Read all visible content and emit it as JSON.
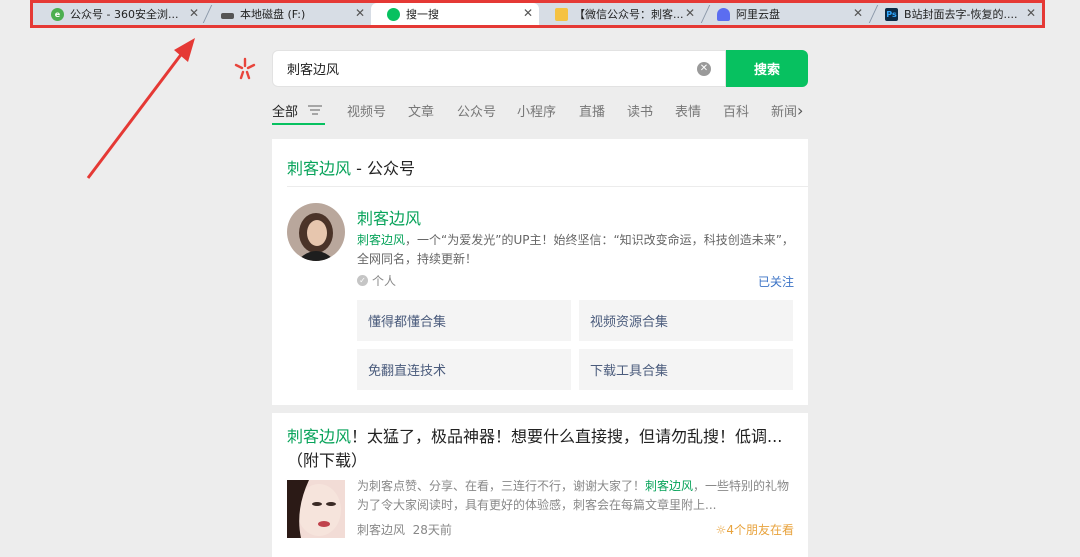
{
  "tabs": [
    {
      "label": "公众号 - 360安全浏...",
      "icon": "ie-icon",
      "color": "#4caf50"
    },
    {
      "label": "本地磁盘 (F:)",
      "icon": "disk-icon",
      "color": "#555555"
    },
    {
      "label": "搜一搜",
      "icon": "wechat-icon",
      "color": "#07c160"
    },
    {
      "label": "【微信公众号：刺客...",
      "icon": "doc-icon",
      "color": "#f5c242"
    },
    {
      "label": "阿里云盘",
      "icon": "cloud-icon",
      "color": "#5b6df0"
    },
    {
      "label": "B站封面去字-恢复的....",
      "icon": "photoshop-icon",
      "color": "#0d2b45"
    }
  ],
  "search": {
    "value": "刺客边风",
    "button": "搜索"
  },
  "categories": [
    "全部",
    "视频号",
    "文章",
    "公众号",
    "小程序",
    "直播",
    "读书",
    "表情",
    "百科",
    "新闻"
  ],
  "account_card": {
    "title_highlight": "刺客边风",
    "title_rest": " - 公众号",
    "name": "刺客边风",
    "desc_highlight": "刺客边风",
    "desc_rest": "，一个“为爱发光”的UP主！始终坚信：“知识改变命运，科技创造未来”，全网同名，持续更新！",
    "type": "个人",
    "followed": "已关注",
    "menus": [
      "懂得都懂合集",
      "视频资源合集",
      "免翻直连技术",
      "下载工具合集"
    ]
  },
  "article": {
    "title_highlight": "刺客边风",
    "title_rest": "！太猛了，极品神器！想要什么直接搜，但请勿乱搜！低调...（附下载）",
    "desc_part1": "为刺客点赞、分享、在看，三连行不行，谢谢大家了！",
    "desc_highlight": "刺客边风",
    "desc_part2": "，一些特别的礼物为了令大家阅读时，具有更好的体验感，刺客会在每篇文章里附上...",
    "source": "刺客边风",
    "time": "28天前",
    "friends": "4个朋友在看"
  },
  "colors": {
    "accent": "#07c160",
    "highlight": "#07a35a",
    "link": "#3b73c6",
    "annotation": "#e53935"
  }
}
